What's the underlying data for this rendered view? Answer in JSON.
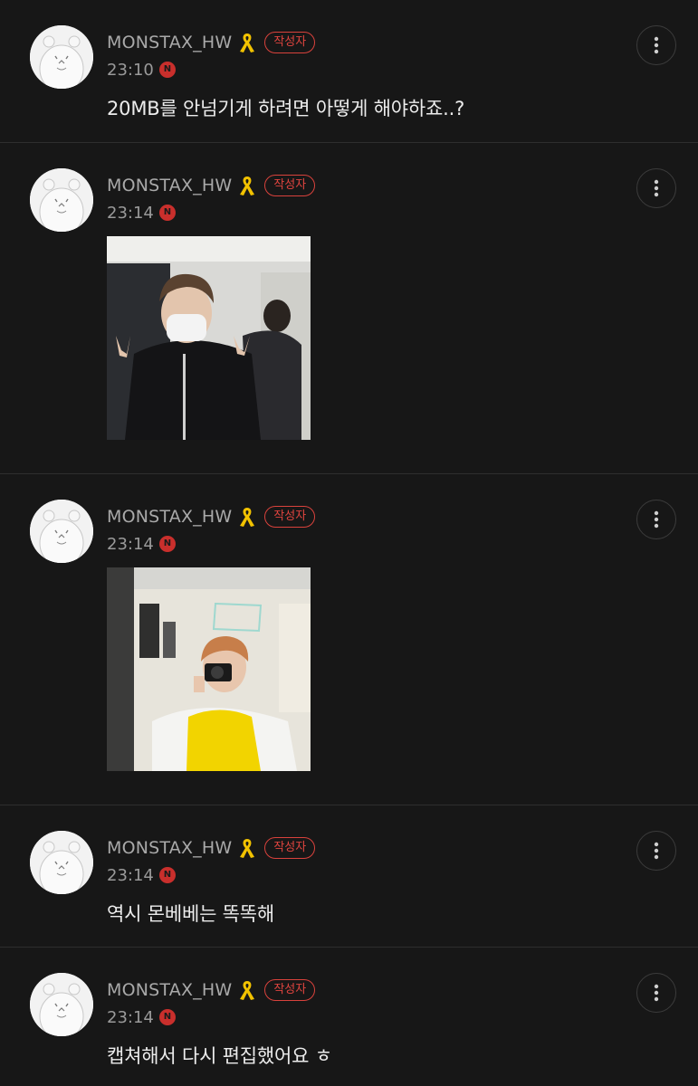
{
  "user": {
    "name": "MONSTAX_HW",
    "author_badge": "작성자",
    "new_badge": "N",
    "ribbon_color": "#f2c200",
    "badge_color": "#d9423c"
  },
  "comments": [
    {
      "time": "23:10",
      "text": "20MB를 안넘기게 하려면 아떻게 해야하죠..?"
    },
    {
      "time": "23:14",
      "image": "photo-two-people-peace-sign"
    },
    {
      "time": "23:14",
      "image": "photo-mirror-selfie-camera"
    },
    {
      "time": "23:14",
      "text": "역시 몬베베는 똑똑해"
    },
    {
      "time": "23:14",
      "text": "캡쳐해서 다시 편집했어요 ㅎ"
    }
  ]
}
